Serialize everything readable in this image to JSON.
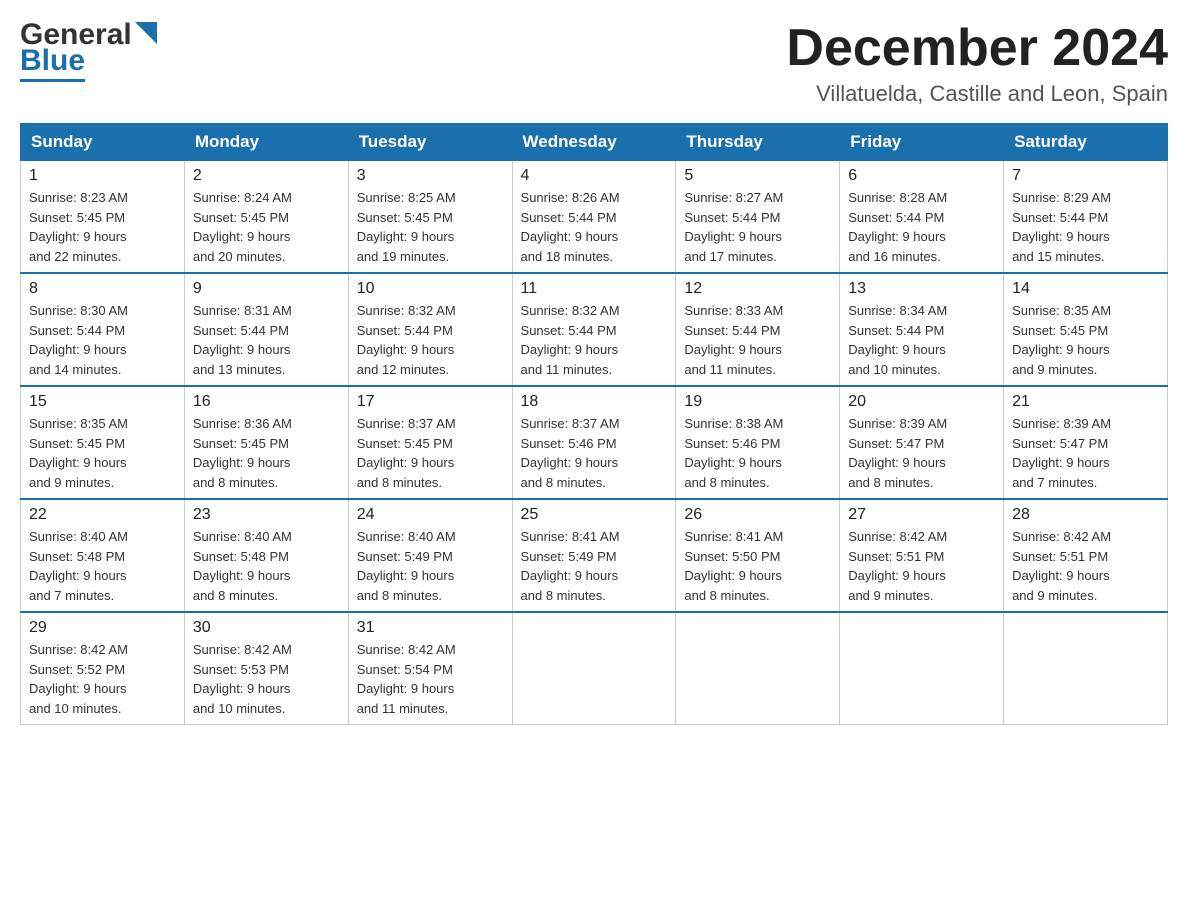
{
  "header": {
    "logo_general": "General",
    "logo_blue": "Blue",
    "month_title": "December 2024",
    "location": "Villatuelda, Castille and Leon, Spain"
  },
  "days_of_week": [
    "Sunday",
    "Monday",
    "Tuesday",
    "Wednesday",
    "Thursday",
    "Friday",
    "Saturday"
  ],
  "weeks": [
    [
      {
        "day": "1",
        "sunrise": "8:23 AM",
        "sunset": "5:45 PM",
        "daylight": "9 hours and 22 minutes."
      },
      {
        "day": "2",
        "sunrise": "8:24 AM",
        "sunset": "5:45 PM",
        "daylight": "9 hours and 20 minutes."
      },
      {
        "day": "3",
        "sunrise": "8:25 AM",
        "sunset": "5:45 PM",
        "daylight": "9 hours and 19 minutes."
      },
      {
        "day": "4",
        "sunrise": "8:26 AM",
        "sunset": "5:44 PM",
        "daylight": "9 hours and 18 minutes."
      },
      {
        "day": "5",
        "sunrise": "8:27 AM",
        "sunset": "5:44 PM",
        "daylight": "9 hours and 17 minutes."
      },
      {
        "day": "6",
        "sunrise": "8:28 AM",
        "sunset": "5:44 PM",
        "daylight": "9 hours and 16 minutes."
      },
      {
        "day": "7",
        "sunrise": "8:29 AM",
        "sunset": "5:44 PM",
        "daylight": "9 hours and 15 minutes."
      }
    ],
    [
      {
        "day": "8",
        "sunrise": "8:30 AM",
        "sunset": "5:44 PM",
        "daylight": "9 hours and 14 minutes."
      },
      {
        "day": "9",
        "sunrise": "8:31 AM",
        "sunset": "5:44 PM",
        "daylight": "9 hours and 13 minutes."
      },
      {
        "day": "10",
        "sunrise": "8:32 AM",
        "sunset": "5:44 PM",
        "daylight": "9 hours and 12 minutes."
      },
      {
        "day": "11",
        "sunrise": "8:32 AM",
        "sunset": "5:44 PM",
        "daylight": "9 hours and 11 minutes."
      },
      {
        "day": "12",
        "sunrise": "8:33 AM",
        "sunset": "5:44 PM",
        "daylight": "9 hours and 11 minutes."
      },
      {
        "day": "13",
        "sunrise": "8:34 AM",
        "sunset": "5:44 PM",
        "daylight": "9 hours and 10 minutes."
      },
      {
        "day": "14",
        "sunrise": "8:35 AM",
        "sunset": "5:45 PM",
        "daylight": "9 hours and 9 minutes."
      }
    ],
    [
      {
        "day": "15",
        "sunrise": "8:35 AM",
        "sunset": "5:45 PM",
        "daylight": "9 hours and 9 minutes."
      },
      {
        "day": "16",
        "sunrise": "8:36 AM",
        "sunset": "5:45 PM",
        "daylight": "9 hours and 8 minutes."
      },
      {
        "day": "17",
        "sunrise": "8:37 AM",
        "sunset": "5:45 PM",
        "daylight": "9 hours and 8 minutes."
      },
      {
        "day": "18",
        "sunrise": "8:37 AM",
        "sunset": "5:46 PM",
        "daylight": "9 hours and 8 minutes."
      },
      {
        "day": "19",
        "sunrise": "8:38 AM",
        "sunset": "5:46 PM",
        "daylight": "9 hours and 8 minutes."
      },
      {
        "day": "20",
        "sunrise": "8:39 AM",
        "sunset": "5:47 PM",
        "daylight": "9 hours and 8 minutes."
      },
      {
        "day": "21",
        "sunrise": "8:39 AM",
        "sunset": "5:47 PM",
        "daylight": "9 hours and 7 minutes."
      }
    ],
    [
      {
        "day": "22",
        "sunrise": "8:40 AM",
        "sunset": "5:48 PM",
        "daylight": "9 hours and 7 minutes."
      },
      {
        "day": "23",
        "sunrise": "8:40 AM",
        "sunset": "5:48 PM",
        "daylight": "9 hours and 8 minutes."
      },
      {
        "day": "24",
        "sunrise": "8:40 AM",
        "sunset": "5:49 PM",
        "daylight": "9 hours and 8 minutes."
      },
      {
        "day": "25",
        "sunrise": "8:41 AM",
        "sunset": "5:49 PM",
        "daylight": "9 hours and 8 minutes."
      },
      {
        "day": "26",
        "sunrise": "8:41 AM",
        "sunset": "5:50 PM",
        "daylight": "9 hours and 8 minutes."
      },
      {
        "day": "27",
        "sunrise": "8:42 AM",
        "sunset": "5:51 PM",
        "daylight": "9 hours and 9 minutes."
      },
      {
        "day": "28",
        "sunrise": "8:42 AM",
        "sunset": "5:51 PM",
        "daylight": "9 hours and 9 minutes."
      }
    ],
    [
      {
        "day": "29",
        "sunrise": "8:42 AM",
        "sunset": "5:52 PM",
        "daylight": "9 hours and 10 minutes."
      },
      {
        "day": "30",
        "sunrise": "8:42 AM",
        "sunset": "5:53 PM",
        "daylight": "9 hours and 10 minutes."
      },
      {
        "day": "31",
        "sunrise": "8:42 AM",
        "sunset": "5:54 PM",
        "daylight": "9 hours and 11 minutes."
      },
      null,
      null,
      null,
      null
    ]
  ],
  "labels": {
    "sunrise": "Sunrise:",
    "sunset": "Sunset:",
    "daylight": "Daylight:"
  }
}
